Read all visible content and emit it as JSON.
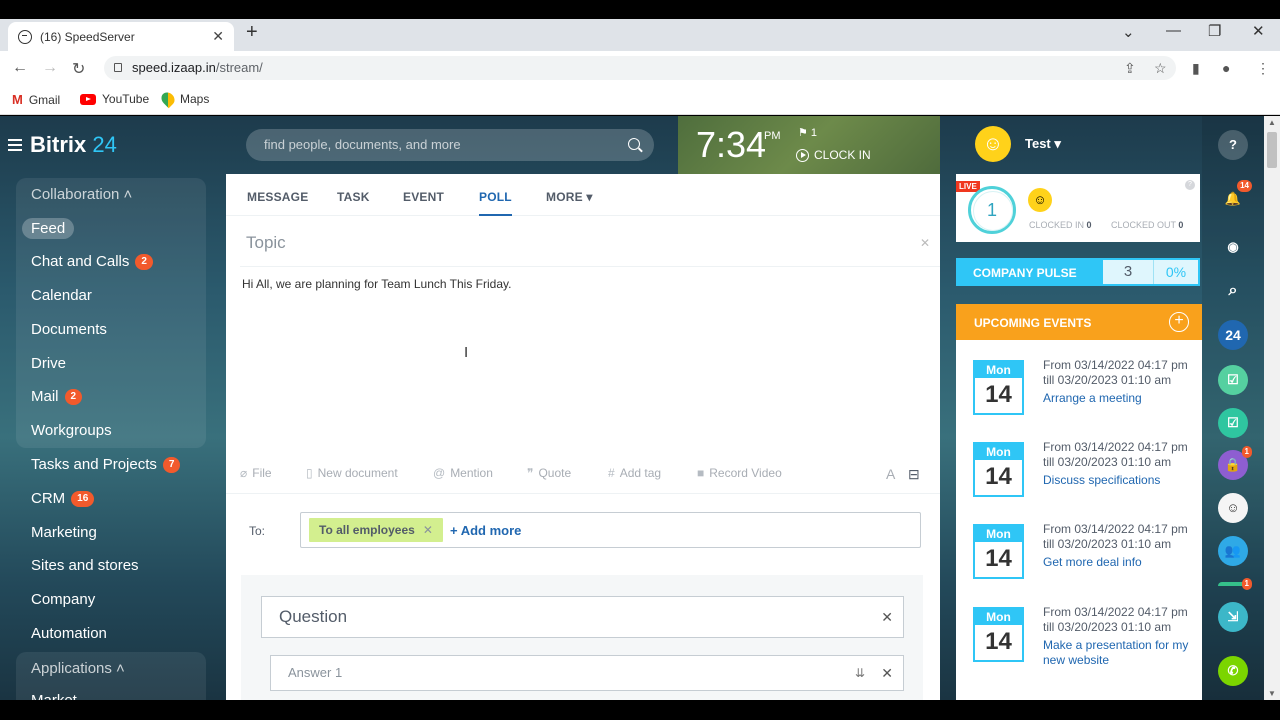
{
  "browser": {
    "tab_title": "(16) SpeedServer",
    "url_host": "speed.izaap.in",
    "url_path": "/stream/",
    "bookmarks": [
      "Gmail",
      "YouTube",
      "Maps"
    ]
  },
  "app": {
    "logo_word": "Bitrix",
    "logo_num": "24",
    "search_placeholder": "find people, documents, and more",
    "time": "7:34",
    "ampm": "PM",
    "flag_count": "1",
    "clock_in": "CLOCK IN",
    "user_name": "Test"
  },
  "sidebar": {
    "group_collab": "Collaboration",
    "items": [
      {
        "label": "Feed",
        "badge": ""
      },
      {
        "label": "Chat and Calls",
        "badge": "2"
      },
      {
        "label": "Calendar",
        "badge": ""
      },
      {
        "label": "Documents",
        "badge": ""
      },
      {
        "label": "Drive",
        "badge": ""
      },
      {
        "label": "Mail",
        "badge": "2"
      },
      {
        "label": "Workgroups",
        "badge": ""
      },
      {
        "label": "Tasks and Projects",
        "badge": "7"
      },
      {
        "label": "CRM",
        "badge": "16"
      },
      {
        "label": "Marketing",
        "badge": ""
      },
      {
        "label": "Sites and stores",
        "badge": ""
      },
      {
        "label": "Company",
        "badge": ""
      },
      {
        "label": "Automation",
        "badge": ""
      }
    ],
    "group_apps": "Applications",
    "market": "Market"
  },
  "composer": {
    "tabs": [
      "MESSAGE",
      "TASK",
      "EVENT",
      "POLL",
      "MORE"
    ],
    "topic_placeholder": "Topic",
    "body": "Hi All, we are planning for Team Lunch This Friday.",
    "tools": [
      "File",
      "New document",
      "Mention",
      "Quote",
      "Add tag",
      "Record Video"
    ],
    "to_label": "To:",
    "recipient": "To all employees",
    "add_more": "+ Add more",
    "question_placeholder": "Question",
    "answer_placeholder": "Answer  1"
  },
  "timeman": {
    "live": "LIVE",
    "count": "1",
    "clocked_in_label": "CLOCKED IN",
    "clocked_in": "0",
    "clocked_out_label": "CLOCKED OUT",
    "clocked_out": "0"
  },
  "pulse": {
    "label": "COMPANY PULSE",
    "value": "3",
    "percent": "0%"
  },
  "events": {
    "header": "UPCOMING EVENTS",
    "items": [
      {
        "day": "Mon",
        "date": "14",
        "range": "From 03/14/2022 04:17 pm till 03/20/2023 01:10 am",
        "title": "Arrange a meeting"
      },
      {
        "day": "Mon",
        "date": "14",
        "range": "From 03/14/2022 04:17 pm till 03/20/2023 01:10 am",
        "title": "Discuss specifications"
      },
      {
        "day": "Mon",
        "date": "14",
        "range": "From 03/14/2022 04:17 pm till 03/20/2023 01:10 am",
        "title": "Get more deal info"
      },
      {
        "day": "Mon",
        "date": "14",
        "range": "From 03/14/2022 04:17 pm till 03/20/2023 01:10 am",
        "title": "Make a presentation for my new website"
      }
    ]
  },
  "rightbar": {
    "notif_badge": "14",
    "brand": "24",
    "lock_badge": "1",
    "group_badge": "1"
  },
  "colors": {
    "accent": "#2fc6f6",
    "orange": "#f9a11c",
    "badge": "#f25a2c",
    "link": "#2067b0"
  }
}
